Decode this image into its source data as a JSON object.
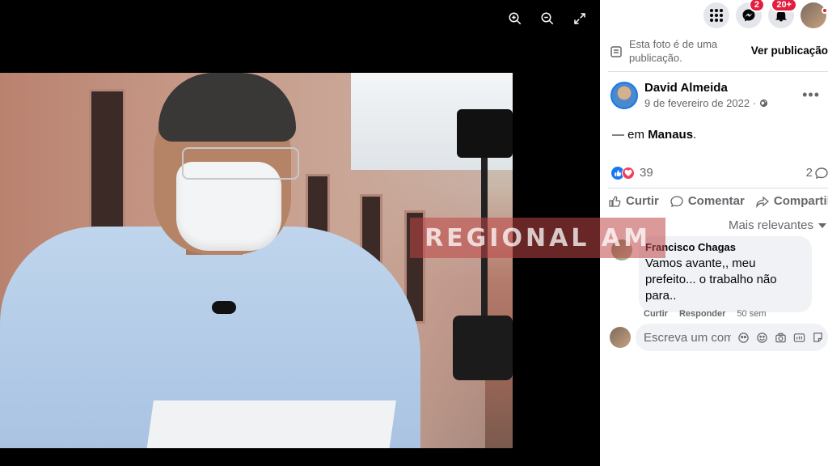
{
  "viewer": {
    "tools": [
      "zoom-in",
      "zoom-out",
      "fullscreen"
    ]
  },
  "watermark": "REGIONAL AM",
  "topbar": {
    "messenger_badge": "2",
    "notifications_badge": "20+"
  },
  "post_note": {
    "text": "Esta foto é de uma publicação.",
    "link": "Ver publicação"
  },
  "post": {
    "author": "David Almeida",
    "date": "9 de fevereiro de 2022 ·",
    "text_prefix": "— em ",
    "location": "Manaus",
    "text_suffix": ".",
    "reactions_count": "39",
    "comments_count": "2"
  },
  "actions": {
    "like": "Curtir",
    "comment": "Comentar",
    "share": "Compartilhar"
  },
  "sort": "Mais relevantes",
  "comment": {
    "author": "Francisco Chagas",
    "text": "Vamos avante,, meu prefeito... o trabalho não para..",
    "like": "Curtir",
    "reply": "Responder",
    "ago": "50 sem"
  },
  "composer": {
    "placeholder": "Escreva um comentário..."
  },
  "colors": {
    "accent": "#1877f2",
    "love": "#f33e58",
    "badge": "#e41e3f",
    "muted": "#65676b"
  }
}
